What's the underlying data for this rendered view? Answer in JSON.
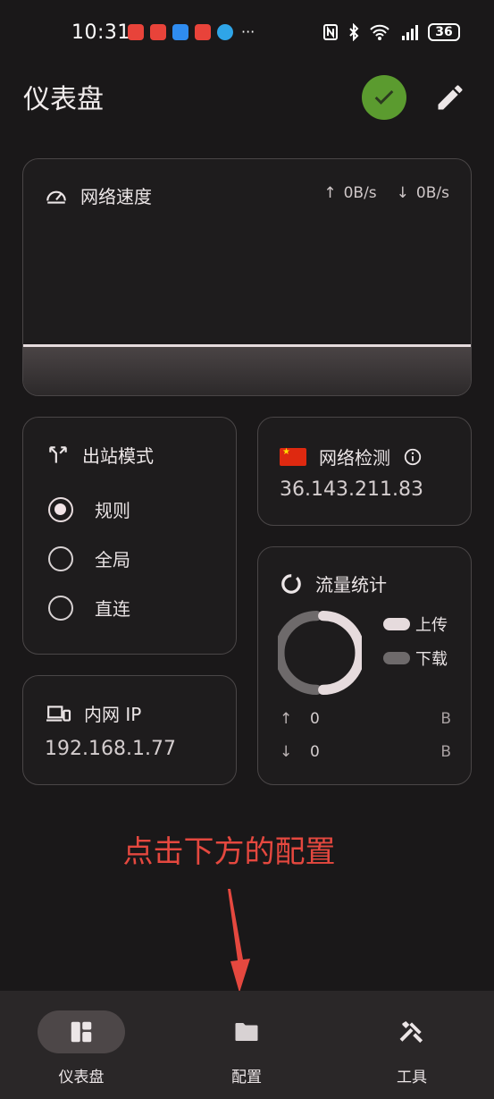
{
  "status_bar": {
    "time": "10:31",
    "more": "···",
    "battery": "36",
    "icons": [
      "nfc-icon",
      "bluetooth-icon",
      "wifi-icon",
      "signal-5g-icon",
      "battery-icon"
    ]
  },
  "header": {
    "title": "仪表盘",
    "status_color": "#5b9b2f"
  },
  "network_speed": {
    "title": "网络速度",
    "upload": "0B/s",
    "download": "0B/s"
  },
  "outbound_mode": {
    "title": "出站模式",
    "options": [
      {
        "label": "规则",
        "selected": true
      },
      {
        "label": "全局",
        "selected": false
      },
      {
        "label": "直连",
        "selected": false
      }
    ]
  },
  "network_check": {
    "title": "网络检测",
    "ip": "36.143.211.83"
  },
  "lan_ip": {
    "title": "内网 IP",
    "ip": "192.168.1.77"
  },
  "traffic": {
    "title": "流量统计",
    "legend_upload": "上传",
    "legend_download": "下载",
    "upload_value": "0",
    "upload_unit": "B",
    "download_value": "0",
    "download_unit": "B",
    "upload_color": "#e6dbdd",
    "download_color": "#6e6a6b"
  },
  "annotation": {
    "text": "点击下方的配置",
    "color": "#e5483f"
  },
  "bottom_nav": {
    "items": [
      {
        "label": "仪表盘",
        "active": true
      },
      {
        "label": "配置",
        "active": false
      },
      {
        "label": "工具",
        "active": false
      }
    ]
  }
}
